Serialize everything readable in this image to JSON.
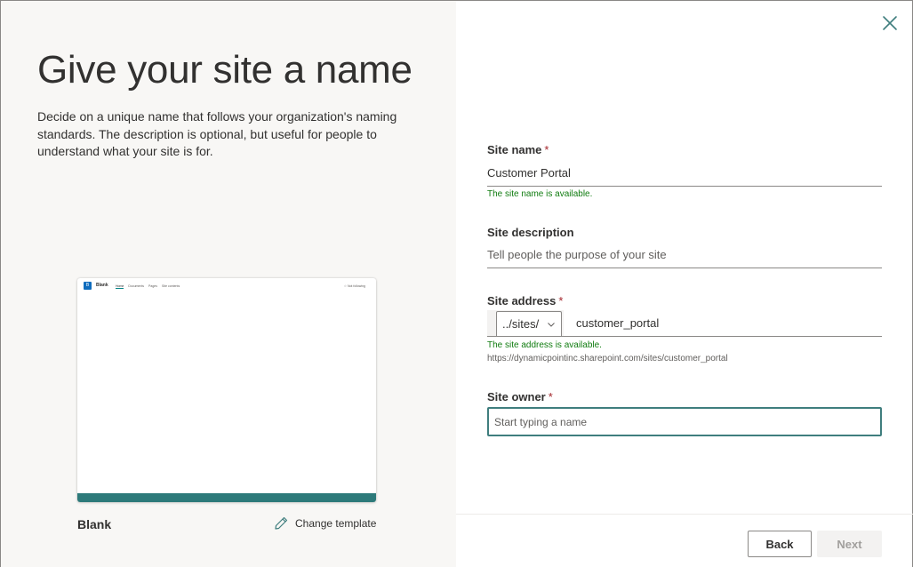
{
  "left": {
    "headline": "Give your site a name",
    "intro": "Decide on a unique name that follows your organization's naming standards. The description is optional, but useful for people to understand what your site is for.",
    "preview": {
      "logo_letter": "B",
      "site_title": "Blank",
      "nav": [
        "Home",
        "Documents",
        "Pages",
        "Site contents"
      ],
      "follow": "☆ Not following"
    },
    "template_name": "Blank",
    "change_template": "Change template"
  },
  "form": {
    "site_name": {
      "label": "Site name",
      "required": "*",
      "value": "Customer Portal",
      "status": "The site name is available."
    },
    "site_description": {
      "label": "Site description",
      "placeholder": "Tell people the purpose of your site"
    },
    "site_address": {
      "label": "Site address",
      "required": "*",
      "prefix": "../sites/",
      "value": "customer_portal",
      "status": "The site address is available.",
      "full_url": "https://dynamicpointinc.sharepoint.com/sites/customer_portal"
    },
    "site_owner": {
      "label": "Site owner",
      "required": "*",
      "placeholder": "Start typing a name"
    }
  },
  "footer": {
    "back": "Back",
    "next": "Next"
  },
  "icons": {
    "close": "close-icon",
    "pencil": "pencil-icon",
    "chevron": "chevron-down-icon"
  },
  "colors": {
    "accent": "#3f7e7e",
    "available": "#107c10",
    "required": "#a4262c",
    "template_bar": "#2d7a7a"
  }
}
